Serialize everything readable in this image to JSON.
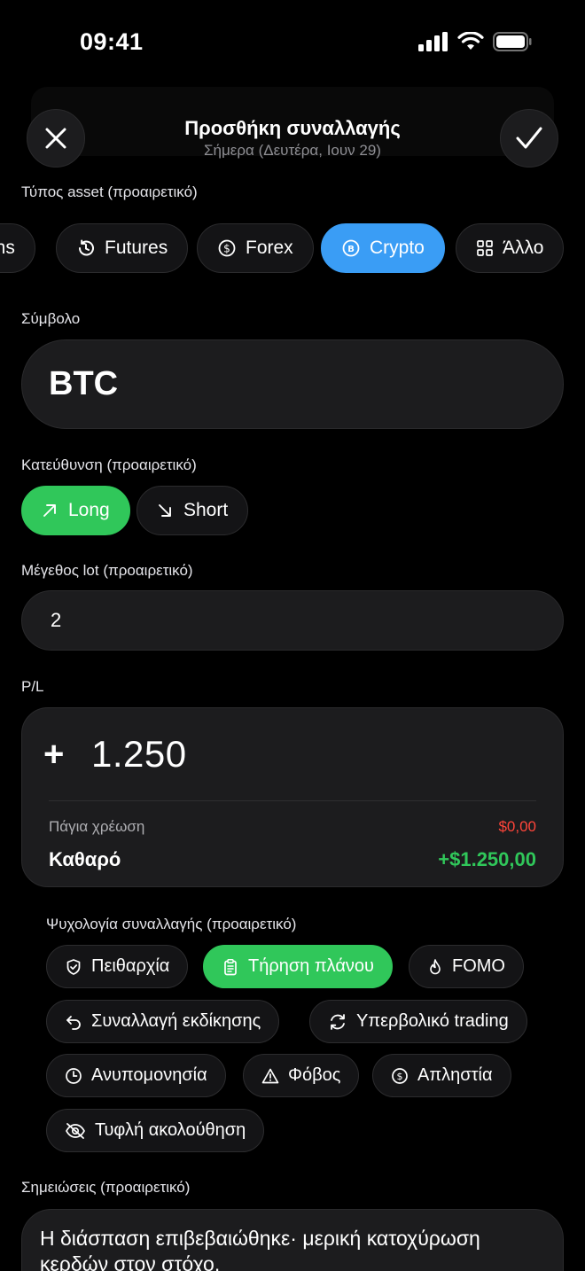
{
  "status_bar": {
    "time": "09:41"
  },
  "header": {
    "title": "Προσθήκη συναλλαγής",
    "subtitle": "Σήμερα (Δευτέρα, Ιουν 29)"
  },
  "asset_type": {
    "label": "Τύπος asset (προαιρετικό)",
    "options": [
      {
        "label": "ons",
        "icon": "options-icon",
        "selected": false
      },
      {
        "label": "Futures",
        "icon": "history-icon",
        "selected": false
      },
      {
        "label": "Forex",
        "icon": "dollar-icon",
        "selected": false
      },
      {
        "label": "Crypto",
        "icon": "bitcoin-icon",
        "selected": true
      },
      {
        "label": "Άλλο",
        "icon": "grid-icon",
        "selected": false
      }
    ]
  },
  "symbol": {
    "label": "Σύμβολο",
    "value": "BTC"
  },
  "direction": {
    "label": "Κατεύθυνση (προαιρετικό)",
    "long_label": "Long",
    "short_label": "Short",
    "selected": "Long"
  },
  "lot_size": {
    "label": "Μέγεθος lot (προαιρετικό)",
    "value": "2"
  },
  "pl": {
    "label": "P/L",
    "sign": "+",
    "value": "1.250",
    "fee_label": "Πάγια χρέωση",
    "fee_value": "$0,00",
    "net_label": "Καθαρό",
    "net_value": "+$1.250,00",
    "colors": {
      "fee": "#ff453a",
      "net": "#30c75a"
    }
  },
  "psychology": {
    "label": "Ψυχολογία συναλλαγής (προαιρετικό)",
    "tags": [
      {
        "label": "Πειθαρχία",
        "icon": "shield-icon",
        "selected": false
      },
      {
        "label": "Τήρηση πλάνου",
        "icon": "clipboard-icon",
        "selected": true
      },
      {
        "label": "FOMO",
        "icon": "flame-icon",
        "selected": false
      },
      {
        "label": "Συναλλαγή εκδίκησης",
        "icon": "undo-icon",
        "selected": false
      },
      {
        "label": "Υπερβολικό trading",
        "icon": "refresh-icon",
        "selected": false
      },
      {
        "label": "Ανυπομονησία",
        "icon": "clock-icon",
        "selected": false
      },
      {
        "label": "Φόβος",
        "icon": "warning-icon",
        "selected": false
      },
      {
        "label": "Απληστία",
        "icon": "dollar-icon",
        "selected": false
      },
      {
        "label": "Τυφλή ακολούθηση",
        "icon": "eye-off-icon",
        "selected": false
      }
    ]
  },
  "notes": {
    "label": "Σημειώσεις (προαιρετικό)",
    "value": "Η διάσπαση επιβεβαιώθηκε· μερική κατοχύρωση κερδών στον στόχο."
  },
  "colors": {
    "accent_blue": "#3a9df5",
    "accent_green": "#30c75a",
    "background": "#000000"
  }
}
